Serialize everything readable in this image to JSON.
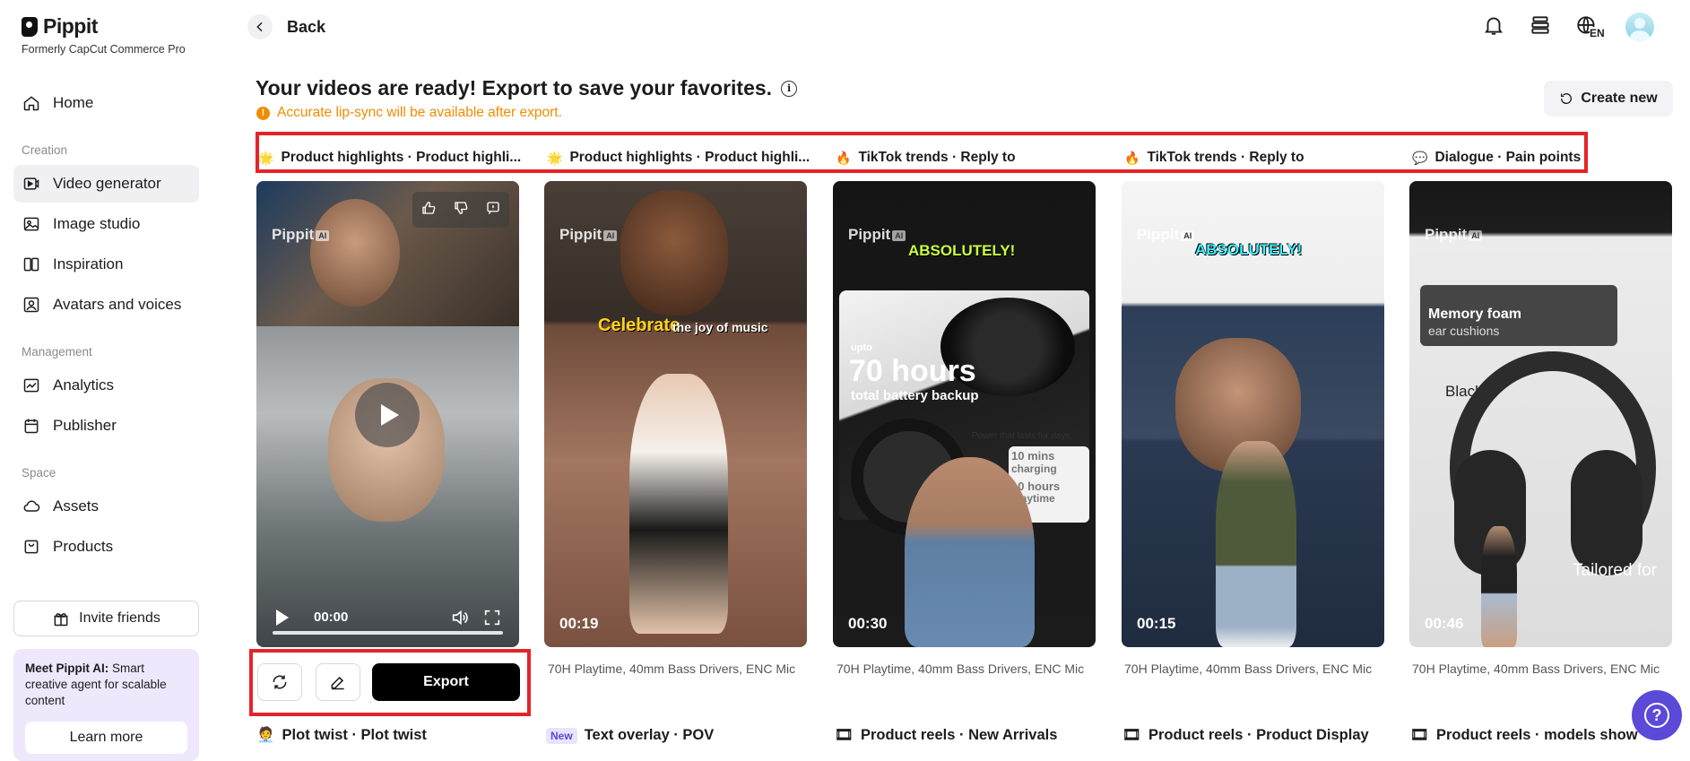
{
  "app": {
    "name": "Pippit",
    "subtitle": "Formerly CapCut Commerce Pro"
  },
  "sidebar": {
    "items": [
      {
        "label": "Home",
        "icon": "home-icon"
      },
      {
        "section": "Creation"
      },
      {
        "label": "Video generator",
        "icon": "video-generator-icon",
        "active": true
      },
      {
        "label": "Image studio",
        "icon": "image-icon"
      },
      {
        "label": "Inspiration",
        "icon": "inspiration-icon"
      },
      {
        "label": "Avatars and voices",
        "icon": "avatar-icon"
      },
      {
        "section": "Management"
      },
      {
        "label": "Analytics",
        "icon": "analytics-icon"
      },
      {
        "label": "Publisher",
        "icon": "calendar-icon"
      },
      {
        "section": "Space"
      },
      {
        "label": "Assets",
        "icon": "cloud-icon"
      },
      {
        "label": "Products",
        "icon": "product-icon"
      }
    ],
    "sections": {
      "creation": "Creation",
      "management": "Management",
      "space": "Space"
    },
    "labels": {
      "home": "Home",
      "video_generator": "Video generator",
      "image_studio": "Image studio",
      "inspiration": "Inspiration",
      "avatars": "Avatars and voices",
      "analytics": "Analytics",
      "publisher": "Publisher",
      "assets": "Assets",
      "products": "Products"
    },
    "invite": "Invite friends",
    "promo": {
      "title": "Meet Pippit AI:",
      "text": " Smart creative agent for scalable content",
      "button": "Learn more"
    }
  },
  "header": {
    "back": "Back",
    "language": "EN"
  },
  "main": {
    "title": "Your videos are ready! Export to save your favorites.",
    "warning": "Accurate lip-sync will be available after export.",
    "create_new": "Create new"
  },
  "tags": [
    {
      "emoji": "🌟",
      "label": "Product highlights · Product highli..."
    },
    {
      "emoji": "🌟",
      "label": "Product highlights · Product highli..."
    },
    {
      "emoji": "🔥",
      "label": "TikTok trends · Reply to"
    },
    {
      "emoji": "🔥",
      "label": "TikTok trends · Reply to"
    },
    {
      "emoji": "💬",
      "label": "Dialogue · Pain points"
    }
  ],
  "cards": [
    {
      "duration": "",
      "player_time": "00:00",
      "caption": ""
    },
    {
      "duration": "00:19",
      "caption": "70H Playtime, 40mm Bass Drivers, ENC Mic",
      "overlay": "Celebrate",
      "overlay2": "the joy of music"
    },
    {
      "duration": "00:30",
      "caption": "70H Playtime, 40mm Bass Drivers, ENC Mic",
      "overlay": "ABSOLUTELY!",
      "big": "70 hours",
      "big_sub": "total battery backup",
      "upto": "upto",
      "power": "Power that lasts for days",
      "mins": "10 mins",
      "charging": "charging",
      "hours": "10 hours",
      "playtime": "playtime"
    },
    {
      "duration": "00:15",
      "caption": "70H Playtime, 40mm Bass Drivers, ENC Mic",
      "overlay": "ABSOLUTELY!"
    },
    {
      "duration": "00:46",
      "caption": "70H Playtime, 40mm Bass Drivers, ENC Mic",
      "memory": "Memory foam",
      "cushions": "ear cushions",
      "black": "Black",
      "tailored": "Tailored for"
    }
  ],
  "watermark": {
    "text": "Pippit",
    "badge": "AI"
  },
  "actions": {
    "export": "Export"
  },
  "bottom_tags": [
    {
      "emoji": "🧑‍💼",
      "label": "Plot twist · Plot twist"
    },
    {
      "badge": "New",
      "label": "Text overlay · POV"
    },
    {
      "emoji": "🎞",
      "label": "Product reels · New Arrivals"
    },
    {
      "emoji": "🎞",
      "label": "Product reels · Product Display"
    },
    {
      "emoji": "🎞",
      "label": "Product reels · models show"
    }
  ],
  "colors": {
    "highlight_border": "#e52329",
    "warning": "#f08c00",
    "accent": "#5b49d8"
  }
}
